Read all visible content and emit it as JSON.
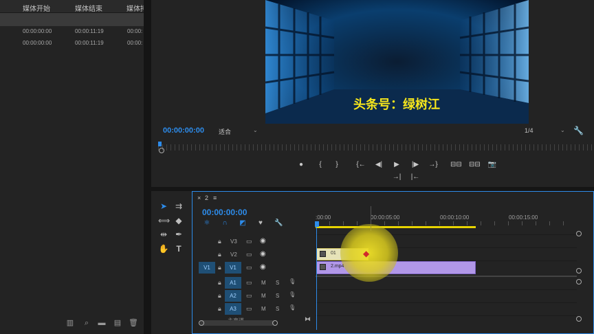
{
  "project": {
    "columns": [
      "媒体开始",
      "媒体结束",
      "媒体持"
    ],
    "rows": [
      {
        "start": "00:00:00:00",
        "end": "00:00:11:19",
        "dur": "00:00:"
      },
      {
        "start": "00:00:00:00",
        "end": "00:00:11:19",
        "dur": "00:00:"
      }
    ]
  },
  "monitor": {
    "video_caption": "头条号：绿树江",
    "timecode": "00:00:00:00",
    "fit_label": "适合",
    "resolution": "1/4",
    "transport": [
      "●",
      "{",
      "}",
      "{←",
      "◀|",
      "▶",
      "|▶",
      "→}",
      "⊟⊟",
      "⊟⊟",
      "📷"
    ],
    "transport2": [
      "→|",
      "|←"
    ]
  },
  "timeline": {
    "tab_close": "×",
    "tab_name": "2",
    "tab_menu": "≡",
    "timecode": "00:00:00:00",
    "ruler_labels": [
      ":00:00",
      "00:00:05:00",
      "00:00:10:00",
      "00:00:15:00"
    ],
    "tracks": [
      {
        "name": "V3",
        "src": ""
      },
      {
        "name": "V2",
        "src": ""
      },
      {
        "name": "V1",
        "src": "V1"
      },
      {
        "name": "A1",
        "src": ""
      },
      {
        "name": "A2",
        "src": ""
      },
      {
        "name": "A3",
        "src": ""
      },
      {
        "name": "主声道",
        "src": ""
      }
    ],
    "clips": [
      {
        "label": "01",
        "track": "V2"
      },
      {
        "label": "2.mp4",
        "track": "V1"
      }
    ],
    "mute_label": "M",
    "solo_label": "S"
  },
  "colors": {
    "accent": "#2d8ceb",
    "clip_video": "#b197e8",
    "clip_text": "#e6e3b8",
    "workarea": "#e8d400"
  }
}
